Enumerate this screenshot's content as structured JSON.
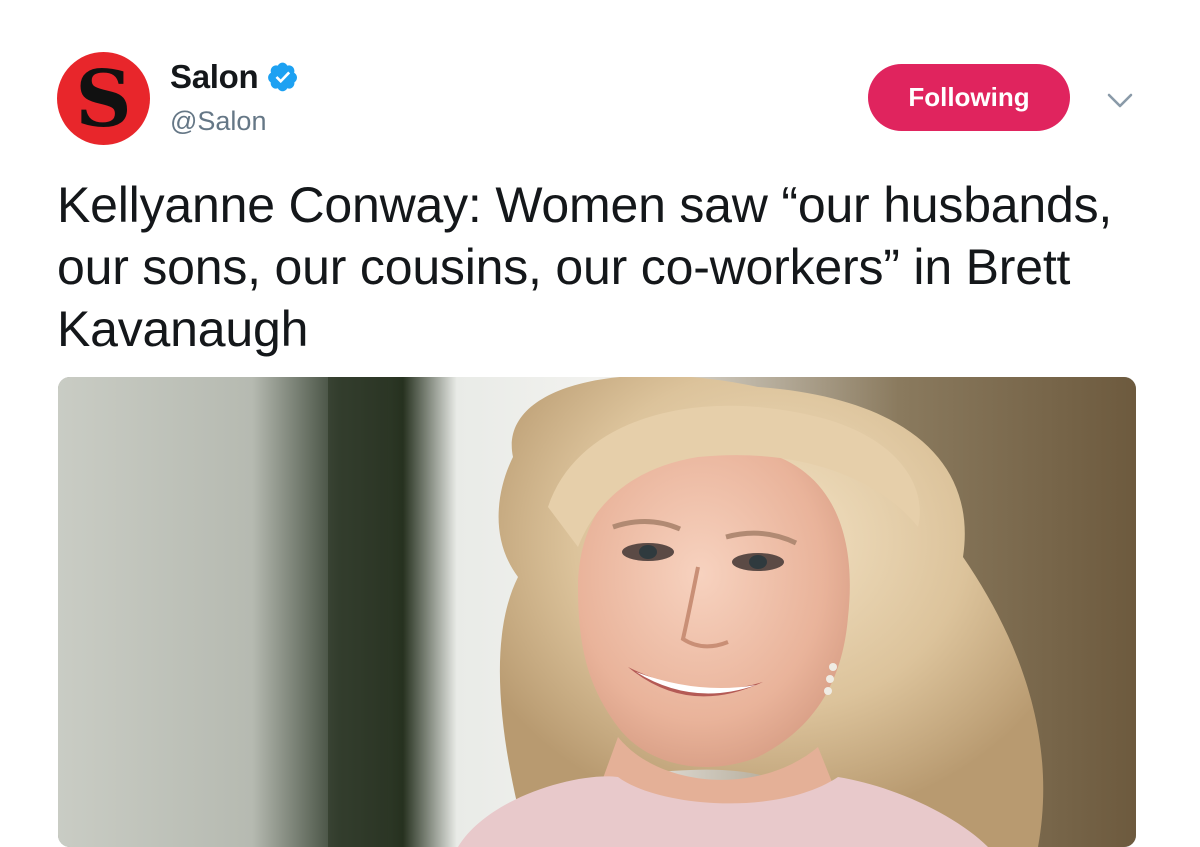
{
  "account": {
    "avatar_letter": "S",
    "display_name": "Salon",
    "handle": "@Salon",
    "verified": true,
    "avatar_color": "#e8262b"
  },
  "actions": {
    "follow_label": "Following",
    "follow_color": "#e0245e",
    "menu_icon": "chevron-down-icon"
  },
  "tweet": {
    "text": "Kellyanne Conway: Women saw “our husbands, our sons, our cousins, our co-workers” in Brett Kavanaugh"
  },
  "media": {
    "type": "photo",
    "icon": "news-photo"
  }
}
